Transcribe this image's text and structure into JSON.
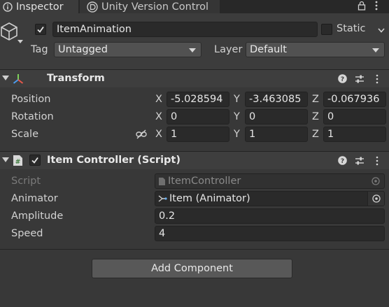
{
  "tabs": [
    {
      "label": "Inspector",
      "icon": "info-icon",
      "active": true
    },
    {
      "label": "Unity Version Control",
      "icon": "version-control-icon",
      "active": false
    }
  ],
  "header": {
    "object_name": "ItemAnimation",
    "active": true,
    "static_label": "Static",
    "static_checked": false,
    "tag_label": "Tag",
    "tag_value": "Untagged",
    "layer_label": "Layer",
    "layer_value": "Default"
  },
  "transform": {
    "title": "Transform",
    "rows": [
      {
        "label": "Position",
        "x": "-5.028594",
        "y": "-3.463085",
        "z": "-0.067936"
      },
      {
        "label": "Rotation",
        "x": "0",
        "y": "0",
        "z": "0"
      },
      {
        "label": "Scale",
        "x": "1",
        "y": "1",
        "z": "1"
      }
    ],
    "axis_labels": [
      "X",
      "Y",
      "Z"
    ]
  },
  "item_controller": {
    "title": "Item Controller (Script)",
    "enabled": true,
    "script_label": "Script",
    "script_value": "ItemController",
    "animator_label": "Animator",
    "animator_value": "Item (Animator)",
    "amplitude_label": "Amplitude",
    "amplitude_value": "0.2",
    "speed_label": "Speed",
    "speed_value": "4"
  },
  "add_component_label": "Add Component",
  "colors": {
    "background": "#383838",
    "field": "#2a2a2a",
    "section_header": "#3e3e3e",
    "text": "#d2d2d2"
  }
}
